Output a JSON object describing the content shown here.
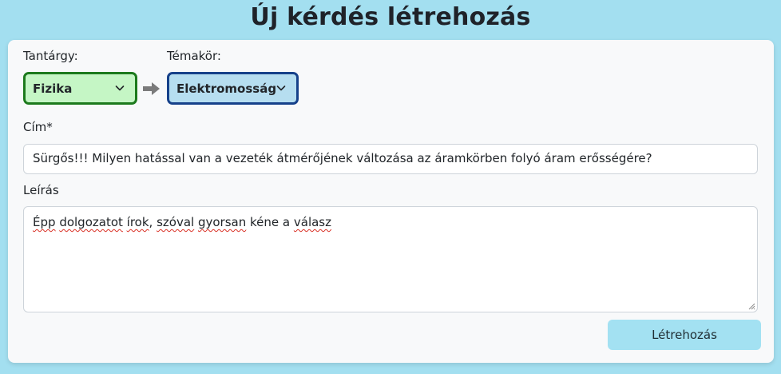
{
  "page": {
    "title": "Új kérdés létrehozás"
  },
  "form": {
    "subject_label": "Tantárgy:",
    "subject_value": "Fizika",
    "topic_label": "Témakör:",
    "topic_value": "Elektromosság",
    "title_label": "Cím*",
    "title_value": "Sürgős!!! Milyen hatással van a vezeték átmérőjének változása az áramkörben folyó áram erősségére?",
    "description_label": "Leírás",
    "description_words": [
      "Épp",
      " ",
      "dolgozatot",
      " ",
      "írok",
      ", ",
      "szóval",
      " ",
      "gyorsan",
      " kéne a ",
      "válasz"
    ],
    "submit_label": "Létrehozás"
  },
  "colors": {
    "background": "#a3dff0",
    "subject_fill": "#c5f6c5",
    "subject_border": "#1c7a1c",
    "topic_fill": "#b6def0",
    "topic_border": "#16418a",
    "submit_fill": "#a3e1f2"
  },
  "icons": {
    "select_chevron": "chevron-down-icon",
    "between_selects": "arrow-right-icon"
  }
}
